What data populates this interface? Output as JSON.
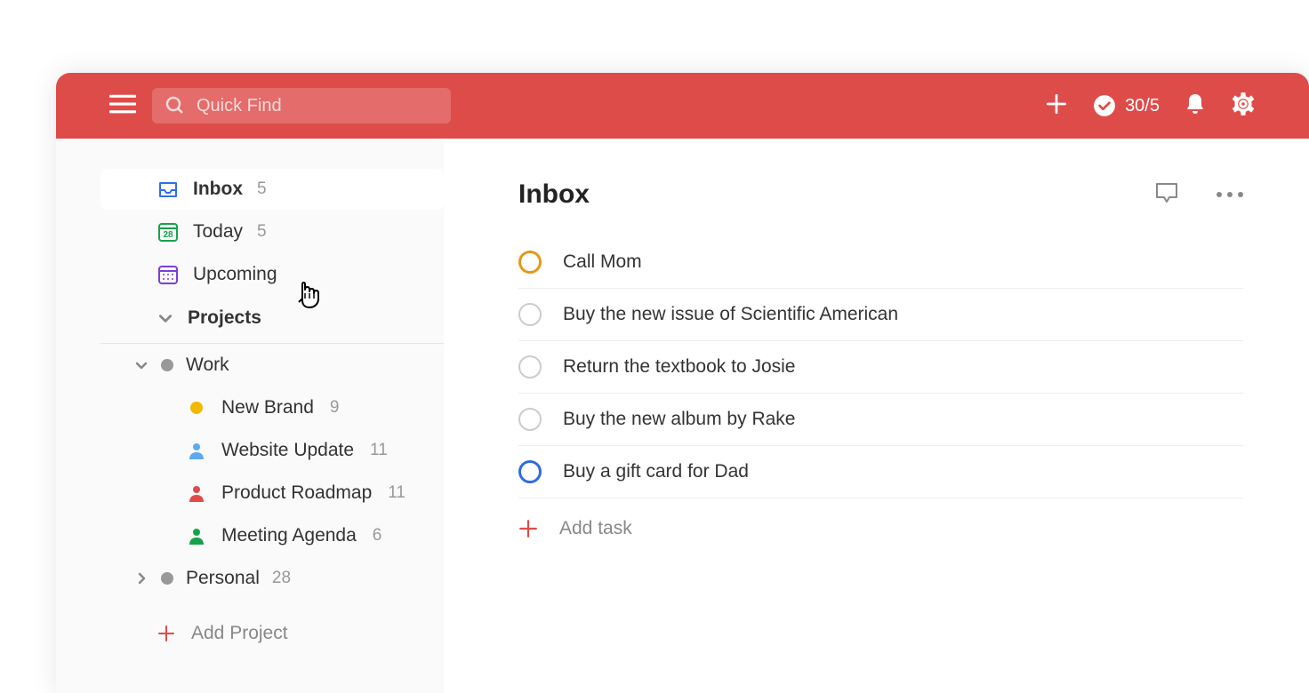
{
  "header": {
    "search_placeholder": "Quick Find",
    "productivity_score": "30/5"
  },
  "sidebar": {
    "nav": [
      {
        "id": "inbox",
        "label": "Inbox",
        "count": "5",
        "selected": true
      },
      {
        "id": "today",
        "label": "Today",
        "count": "5",
        "selected": false,
        "day": "28"
      },
      {
        "id": "upcoming",
        "label": "Upcoming",
        "count": "",
        "selected": false
      }
    ],
    "projects_header": "Projects",
    "categories": [
      {
        "id": "work",
        "label": "Work",
        "expanded": true,
        "color": "#999",
        "projects": [
          {
            "id": "new-brand",
            "label": "New Brand",
            "count": "9",
            "icon": "dot",
            "color": "#F5B800"
          },
          {
            "id": "website-update",
            "label": "Website Update",
            "count": "11",
            "icon": "person",
            "color": "#5DA9F0"
          },
          {
            "id": "product-roadmap",
            "label": "Product Roadmap",
            "count": "11",
            "icon": "person",
            "color": "#DE4C4A"
          },
          {
            "id": "meeting-agenda",
            "label": "Meeting Agenda",
            "count": "6",
            "icon": "person",
            "color": "#17A24A"
          }
        ]
      },
      {
        "id": "personal",
        "label": "Personal",
        "count": "28",
        "expanded": false,
        "color": "#999"
      }
    ],
    "add_project_label": "Add Project"
  },
  "main": {
    "title": "Inbox",
    "tasks": [
      {
        "id": "task1",
        "title": "Call Mom",
        "priority": "orange"
      },
      {
        "id": "task2",
        "title": "Buy the new issue of Scientific American",
        "priority": "none"
      },
      {
        "id": "task3",
        "title": "Return the textbook to Josie",
        "priority": "none"
      },
      {
        "id": "task4",
        "title": "Buy the new album by Rake",
        "priority": "none"
      },
      {
        "id": "task5",
        "title": "Buy a gift card for Dad",
        "priority": "blue"
      }
    ],
    "add_task_label": "Add task"
  }
}
